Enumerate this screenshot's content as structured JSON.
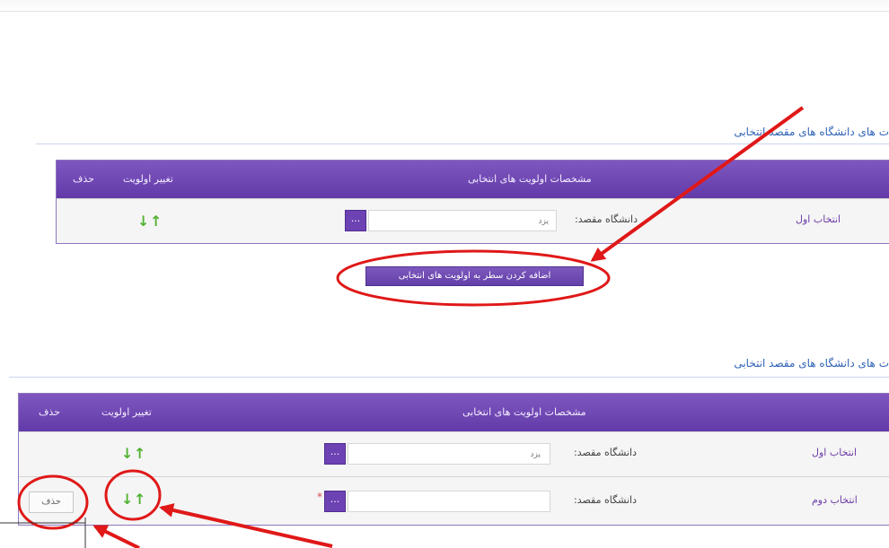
{
  "sections": [
    {
      "title": "ت هاى دانشگاه هاى مقصد انتخابى",
      "headers": {
        "delete": "حذف",
        "change_priority": "تغيير اولويت",
        "details": "مشخصات اولويت هاى انتخابى"
      },
      "rows": [
        {
          "label": "انتخاب اول",
          "field_label": "دانشگاه مقصد:",
          "value": "یزد",
          "lookup_button": "...",
          "priority_arrows": [
            "↓",
            "↑"
          ]
        }
      ],
      "add_button": "اضافه كردن سطر به اولويت هاى انتخابى"
    },
    {
      "title": "ت هاى دانشگاه هاى مقصد انتخابى",
      "headers": {
        "delete": "حذف",
        "change_priority": "تغيير اولويت",
        "details": "مشخصات اولويت هاى انتخابى"
      },
      "rows": [
        {
          "label": "انتخاب اول",
          "field_label": "دانشگاه مقصد:",
          "value": "یزد",
          "lookup_button": "...",
          "priority_arrows": [
            "↓",
            "↑"
          ]
        },
        {
          "label": "انتخاب دوم",
          "field_label": "دانشگاه مقصد:",
          "value": "",
          "lookup_button": "...",
          "required_mark": "*",
          "priority_arrows": [
            "↓",
            "↑"
          ],
          "delete_button": "حذف"
        }
      ]
    }
  ],
  "annotations": {
    "highlight_color": "#e01818",
    "icons": [
      "red-circle-icon",
      "red-arrow-icon"
    ]
  },
  "colors": {
    "header_purple": "#6d42b3",
    "section_title_blue": "#2f63b5",
    "priority_arrow_green": "#52b231"
  }
}
